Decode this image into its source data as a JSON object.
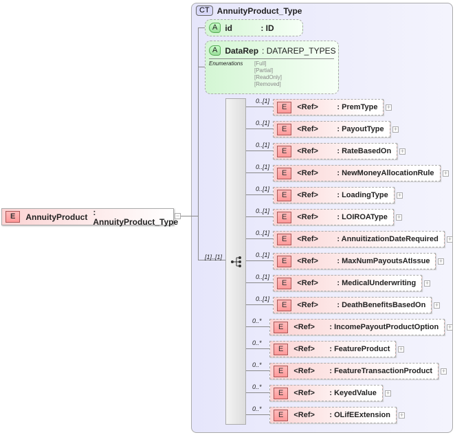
{
  "root": {
    "badge": "E",
    "name": "AnnuityProduct",
    "type": ": AnnuityProduct_Type",
    "collapse": "−"
  },
  "complex_type": {
    "badge": "CT",
    "name": "AnnuityProduct_Type"
  },
  "attributes": [
    {
      "badge": "A",
      "name": "id",
      "type": ": ID"
    },
    {
      "badge": "A",
      "name": "DataRep",
      "type": ": DATAREP_TYPES",
      "enum_label": "Enumerations",
      "enums": [
        "[Full]",
        "[Partial]",
        "[ReadOnly]",
        "[Removed]"
      ]
    }
  ],
  "sequence": {
    "occurrence": "[1]..[1]"
  },
  "children": [
    {
      "occ": "0..[1]",
      "ref": "<Ref>",
      "name": ": PremType"
    },
    {
      "occ": "0..[1]",
      "ref": "<Ref>",
      "name": ": PayoutType"
    },
    {
      "occ": "0..[1]",
      "ref": "<Ref>",
      "name": ": RateBasedOn"
    },
    {
      "occ": "0..[1]",
      "ref": "<Ref>",
      "name": ": NewMoneyAllocationRule"
    },
    {
      "occ": "0..[1]",
      "ref": "<Ref>",
      "name": ": LoadingType"
    },
    {
      "occ": "0..[1]",
      "ref": "<Ref>",
      "name": ": LOIROAType"
    },
    {
      "occ": "0..[1]",
      "ref": "<Ref>",
      "name": ": AnnuitizationDateRequired"
    },
    {
      "occ": "0..[1]",
      "ref": "<Ref>",
      "name": ": MaxNumPayoutsAtIssue"
    },
    {
      "occ": "0..[1]",
      "ref": "<Ref>",
      "name": ": MedicalUnderwriting"
    },
    {
      "occ": "0..[1]",
      "ref": "<Ref>",
      "name": ": DeathBenefitsBasedOn"
    },
    {
      "occ": "0..*",
      "ref": "<Ref>",
      "name": ": IncomePayoutProductOption"
    },
    {
      "occ": "0..*",
      "ref": "<Ref>",
      "name": ": FeatureProduct"
    },
    {
      "occ": "0..*",
      "ref": "<Ref>",
      "name": ": FeatureTransactionProduct"
    },
    {
      "occ": "0..*",
      "ref": "<Ref>",
      "name": ": KeyedValue"
    },
    {
      "occ": "0..*",
      "ref": "<Ref>",
      "name": ": OLifEExtension"
    }
  ],
  "expand_symbol": "+",
  "element_badge": "E"
}
